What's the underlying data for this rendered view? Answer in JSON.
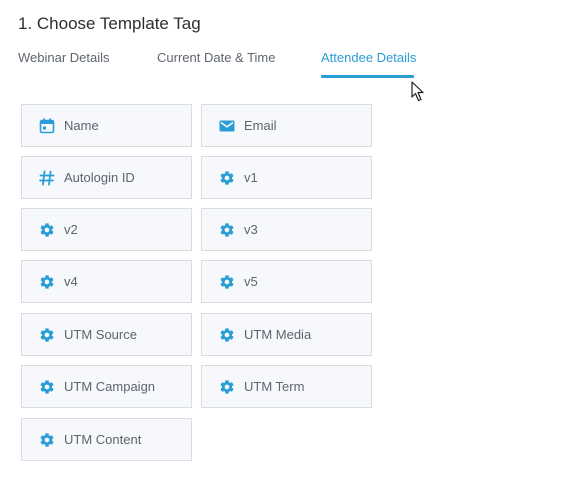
{
  "section_title": "1. Choose Template Tag",
  "tabs": [
    {
      "label": "Webinar Details",
      "active": false
    },
    {
      "label": "Current Date & Time",
      "active": false
    },
    {
      "label": "Attendee Details",
      "active": true
    }
  ],
  "tags": [
    {
      "label": "Name",
      "icon": "calendar-icon"
    },
    {
      "label": "Email",
      "icon": "envelope-icon"
    },
    {
      "label": "Autologin ID",
      "icon": "hash-icon"
    },
    {
      "label": "v1",
      "icon": "gear-icon"
    },
    {
      "label": "v2",
      "icon": "gear-icon"
    },
    {
      "label": "v3",
      "icon": "gear-icon"
    },
    {
      "label": "v4",
      "icon": "gear-icon"
    },
    {
      "label": "v5",
      "icon": "gear-icon"
    },
    {
      "label": "UTM Source",
      "icon": "gear-icon"
    },
    {
      "label": "UTM Media",
      "icon": "gear-icon"
    },
    {
      "label": "UTM Campaign",
      "icon": "gear-icon"
    },
    {
      "label": "UTM Term",
      "icon": "gear-icon"
    },
    {
      "label": "UTM Content",
      "icon": "gear-icon"
    }
  ],
  "colors": {
    "accent": "#2a9dd6",
    "card_background": "#f6f8fb",
    "card_border": "#d9dde3",
    "tab_text": "#5f6670",
    "title_text": "#2b2f33"
  }
}
